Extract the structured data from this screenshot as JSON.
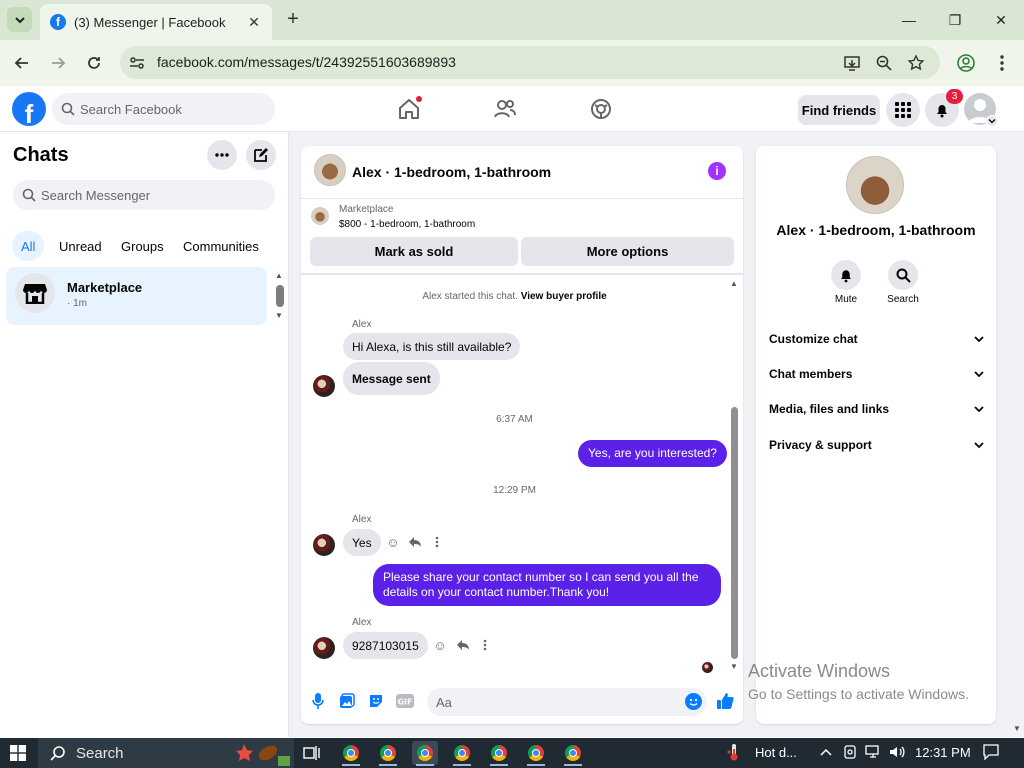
{
  "browser": {
    "tab_title": "(3) Messenger | Facebook",
    "url": "facebook.com/messages/t/24392551603689893"
  },
  "fb_header": {
    "search_placeholder": "Search Facebook",
    "find_friends": "Find friends",
    "notifications_count": "3"
  },
  "sidebar": {
    "title": "Chats",
    "search_placeholder": "Search Messenger",
    "filters": [
      "All",
      "Unread",
      "Groups",
      "Communities"
    ],
    "active_filter": "All",
    "chats": [
      {
        "name": "Marketplace",
        "time": "· 1m"
      }
    ]
  },
  "conversation": {
    "title": "Alex · 1-bedroom, 1-bathroom",
    "marketplace_label": "Marketplace",
    "listing_detail": "$800 - 1-bedroom, 1-bathroom",
    "mark_sold": "Mark as sold",
    "more_options": "More options",
    "system_message": "Alex started this chat.",
    "system_link": "View buyer profile",
    "messages": [
      {
        "sender": "Alex",
        "text": "Hi Alexa, is this still available?"
      },
      {
        "text": "Message sent"
      },
      {
        "timestamp": "6:37 AM"
      },
      {
        "outgoing": true,
        "text": "Yes, are you interested?"
      },
      {
        "timestamp": "12:29 PM"
      },
      {
        "sender": "Alex",
        "text": "Yes"
      },
      {
        "outgoing": true,
        "text": "Please share your contact number so I can send you all the details on your contact number.Thank you!"
      },
      {
        "sender": "Alex",
        "text": "9287103015"
      }
    ],
    "composer_placeholder": "Aa"
  },
  "right_panel": {
    "title": "Alex · 1-bedroom, 1-bathroom",
    "mute": "Mute",
    "search": "Search",
    "sections": [
      "Customize chat",
      "Chat members",
      "Media, files and links",
      "Privacy & support"
    ]
  },
  "watermark": {
    "line1": "Activate Windows",
    "line2": "Go to Settings to activate Windows."
  },
  "taskbar": {
    "search_placeholder": "Search",
    "weather": "Hot d...",
    "time": "12:31 PM"
  },
  "colors": {
    "facebook_blue": "#1877f2",
    "outgoing_bubble": "#5b21e8",
    "incoming_bubble": "#e4e6eb",
    "notification_red": "#e41e3f"
  }
}
